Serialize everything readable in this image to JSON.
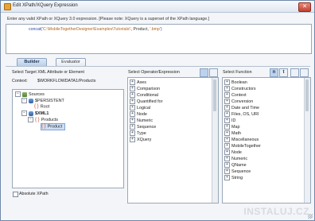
{
  "window": {
    "title": "Edit XPath/XQuery Expression",
    "close_glyph": "✕"
  },
  "instruction": "Enter any valid XPath or XQuery 3.0 expression. [Please note: XQuery is a superset of the XPath language.]",
  "expression": {
    "fn": "concat(",
    "arg1": "'C:\\MobileTogetherDesigner\\Examples\\Tutorials\\'",
    "sep1": ", ",
    "arg2": "Product",
    "sep2": ", ",
    "arg3": "'.bmp'",
    "close": ")"
  },
  "tabs": {
    "builder": "Builder",
    "evaluator": "Evaluator"
  },
  "target_panel": {
    "heading": "Select Target XML Attribute or Element",
    "context_label": "Context:",
    "context_value": "$WORKFLOWDATA1/Products",
    "tree": {
      "sources": "Sources",
      "persistent": "$PERSISTENT",
      "root": "Root",
      "xml1": "$XML1",
      "products": "Products",
      "product": "Product",
      "collapse_glyph": "−",
      "expand_glyph": "+",
      "brace_glyph": "{ }"
    },
    "absolute_xpath": "Absolute XPath"
  },
  "operator_panel": {
    "heading": "Select Operator/Expression",
    "expand_glyph": "+",
    "items": [
      "Axes",
      "Comparison",
      "Conditional",
      "Quantified for",
      "Logical",
      "Node",
      "Numeric",
      "Sequence",
      "Type",
      "XQuery"
    ]
  },
  "function_panel": {
    "heading": "Select Function",
    "btn_n": "n",
    "btn_t": "t",
    "expand_glyph": "+",
    "items": [
      "Boolean",
      "Constructors",
      "Context",
      "Conversion",
      "Date and Time",
      "Files, OS, URI",
      "ID",
      "Map",
      "Math",
      "Miscellaneous",
      "MobileTogether",
      "Node",
      "Numeric",
      "QName",
      "Sequence",
      "String"
    ]
  },
  "watermark": "INSTALUJ.CZ",
  "colors": {
    "accent": "#2a49a8",
    "string": "#b0651c",
    "selection": "#cfe0f6"
  }
}
